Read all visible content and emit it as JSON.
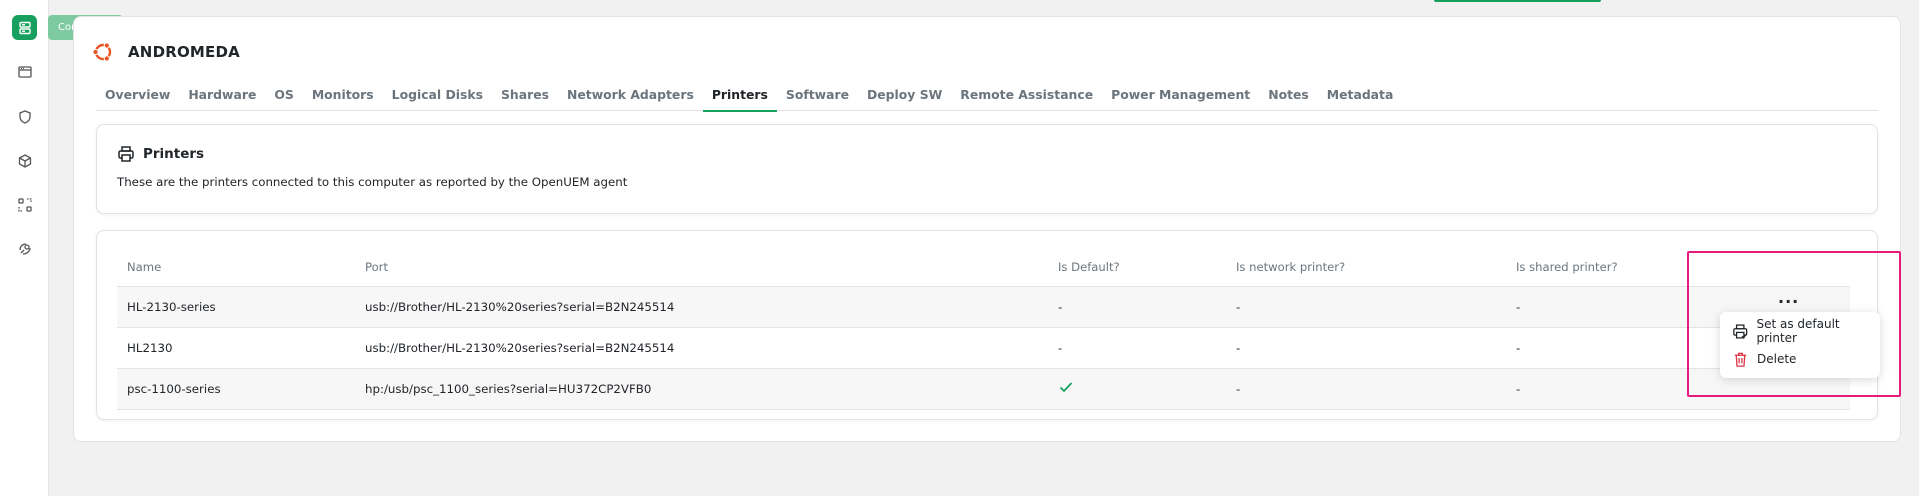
{
  "sidebar": {
    "tooltip": "Computers",
    "items": [
      {
        "name": "computers"
      },
      {
        "name": "browser-window"
      },
      {
        "name": "security"
      },
      {
        "name": "packages"
      },
      {
        "name": "deploy"
      },
      {
        "name": "remote"
      }
    ]
  },
  "computer": {
    "name": "ANDROMEDA",
    "os_icon": "ubuntu-icon"
  },
  "tabs": [
    {
      "label": "Overview"
    },
    {
      "label": "Hardware"
    },
    {
      "label": "OS"
    },
    {
      "label": "Monitors"
    },
    {
      "label": "Logical Disks"
    },
    {
      "label": "Shares"
    },
    {
      "label": "Network Adapters"
    },
    {
      "label": "Printers",
      "active": true
    },
    {
      "label": "Software"
    },
    {
      "label": "Deploy SW"
    },
    {
      "label": "Remote Assistance"
    },
    {
      "label": "Power Management"
    },
    {
      "label": "Notes"
    },
    {
      "label": "Metadata"
    }
  ],
  "info": {
    "title": "Printers",
    "description": "These are the printers connected to this computer as reported by the OpenUEM agent"
  },
  "table": {
    "headers": [
      "Name",
      "Port",
      "Is Default?",
      "Is network printer?",
      "Is shared printer?"
    ],
    "rows": [
      {
        "name": "HL-2130-series",
        "port": "usb://Brother/HL-2130%20series?serial=B2N245514",
        "is_default": "-",
        "is_network": "-",
        "is_shared": "-"
      },
      {
        "name": "HL2130",
        "port": "usb://Brother/HL-2130%20series?serial=B2N245514",
        "is_default": "-",
        "is_network": "-",
        "is_shared": "-"
      },
      {
        "name": "psc-1100-series",
        "port": "hp:/usb/psc_1100_series?serial=HU372CP2VFB0",
        "is_default": "check",
        "is_network": "-",
        "is_shared": "-"
      }
    ],
    "actions_label": "..."
  },
  "menu": {
    "items": [
      {
        "label": "Set as default printer",
        "icon": "printer-check-icon"
      },
      {
        "label": "Delete",
        "icon": "trash-icon"
      }
    ]
  },
  "colors": {
    "accent": "#17a05d",
    "highlight": "#e6197f",
    "danger": "#dc3545",
    "ubuntu": "#e95420"
  }
}
